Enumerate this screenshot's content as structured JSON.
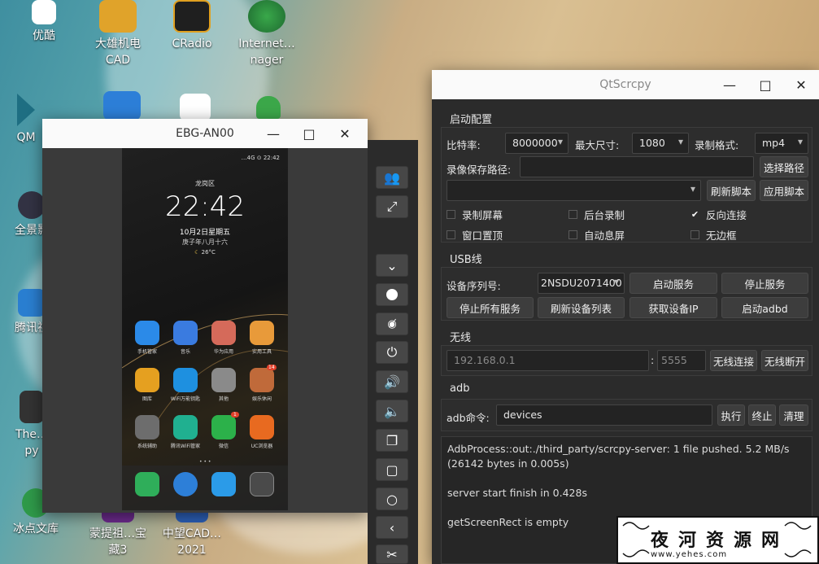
{
  "desktop": {
    "icons": [
      {
        "label": "优酷",
        "color": "#f03a6e"
      },
      {
        "label": "大雄机电CAD",
        "color": "#e0a32a"
      },
      {
        "label": "CRadio",
        "color": "#1f1f1f"
      },
      {
        "label": "Internet…nager",
        "color": "#2e8a3a"
      },
      {
        "label": "QM",
        "color": "#1e6e82"
      },
      {
        "label": "全景影",
        "color": "#345"
      },
      {
        "label": "腾讯视",
        "color": "#2a7fd1"
      },
      {
        "label": "The…py",
        "color": "#333"
      },
      {
        "label": "冰点文库",
        "color": "#2f9a4a"
      },
      {
        "label": "蒙提祖…宝藏3",
        "color": "#6b2a8c"
      },
      {
        "label": "中望CAD…2021",
        "color": "#2c5fb7"
      }
    ]
  },
  "phone_window": {
    "title": "EBG-AN00",
    "status_bar": "…4G ⊙ 22:42",
    "location": "龙岗区",
    "time": "22:42",
    "date": "10月2日星期五",
    "lunar": "庚子年八月十六",
    "weather": "26°C",
    "apps": [
      {
        "label": "手机管家",
        "color": "#2b8ae8"
      },
      {
        "label": "音乐",
        "color": "#3a7be0"
      },
      {
        "label": "华为应用",
        "color": "#d56a5a"
      },
      {
        "label": "实用工具",
        "color": "#e89a3a"
      },
      {
        "label": "图库",
        "color": "#e5a020"
      },
      {
        "label": "WiFi万能钥匙",
        "color": "#1e90e0"
      },
      {
        "label": "其他",
        "color": "#8a8a8a"
      },
      {
        "label": "娱乐休闲",
        "color": "#c06a3a"
      },
      {
        "label": "系统辅助",
        "color": "#6d6d6d"
      },
      {
        "label": "腾讯WiFi管家",
        "color": "#20b090"
      },
      {
        "label": "微信",
        "color": "#2cb14a"
      },
      {
        "label": "UC浏览器",
        "color": "#e86a20"
      }
    ],
    "badge_weixin": "1",
    "badge_games": "14",
    "dock": [
      {
        "name": "phone",
        "color": "#2fae5a"
      },
      {
        "name": "browser",
        "color": "#2d7fd8"
      },
      {
        "name": "messages",
        "color": "#2b9be8"
      },
      {
        "name": "camera",
        "color": "#4a4a4a"
      }
    ]
  },
  "toolbar": {
    "buttons": [
      "users-icon",
      "fullscreen-icon",
      "chevrons-down-icon",
      "record-icon",
      "eye-off-icon",
      "power-icon",
      "volume-up-icon",
      "volume-down-icon",
      "app-switch-icon",
      "home-icon",
      "circle-icon",
      "back-icon",
      "scissors-icon"
    ]
  },
  "qtscrcpy": {
    "title": "QtScrcpy",
    "launch_config": {
      "heading": "启动配置",
      "bitrate_label": "比特率:",
      "bitrate_value": "8000000",
      "max_size_label": "最大尺寸:",
      "max_size_value": "1080",
      "format_label": "录制格式:",
      "format_value": "mp4",
      "record_path_label": "录像保存路径:",
      "record_path_value": "",
      "select_path": "选择路径",
      "script_value": "",
      "refresh_script": "刷新脚本",
      "apply_script": "应用脚本",
      "checkboxes": [
        {
          "label": "录制屏幕",
          "checked": false
        },
        {
          "label": "后台录制",
          "checked": false
        },
        {
          "label": "反向连接",
          "checked": true
        },
        {
          "label": "窗口置顶",
          "checked": false
        },
        {
          "label": "自动息屏",
          "checked": false
        },
        {
          "label": "无边框",
          "checked": false
        }
      ]
    },
    "usb": {
      "heading": "USB线",
      "serial_label": "设备序列号:",
      "serial_value": "2NSDU2071400",
      "start_service": "启动服务",
      "stop_service": "停止服务",
      "stop_all": "停止所有服务",
      "refresh_devices": "刷新设备列表",
      "get_ip": "获取设备IP",
      "start_adbd": "启动adbd"
    },
    "wireless": {
      "heading": "无线",
      "ip_placeholder": "192.168.0.1",
      "colon": ":",
      "port_placeholder": "5555",
      "connect": "无线连接",
      "disconnect": "无线断开"
    },
    "adb": {
      "heading": "adb",
      "cmd_label": "adb命令:",
      "cmd_value": "devices",
      "execute": "执行",
      "terminate": "终止",
      "clear": "清理"
    },
    "log": [
      "AdbProcess::out:./third_party/scrcpy-server: 1 file pushed. 5.2 MB/s (26142 bytes in 0.005s)",
      "server start finish in 0.428s",
      "getScreenRect is empty"
    ]
  },
  "watermark": {
    "title": "夜河资源网",
    "url": "www.yehes.com"
  }
}
